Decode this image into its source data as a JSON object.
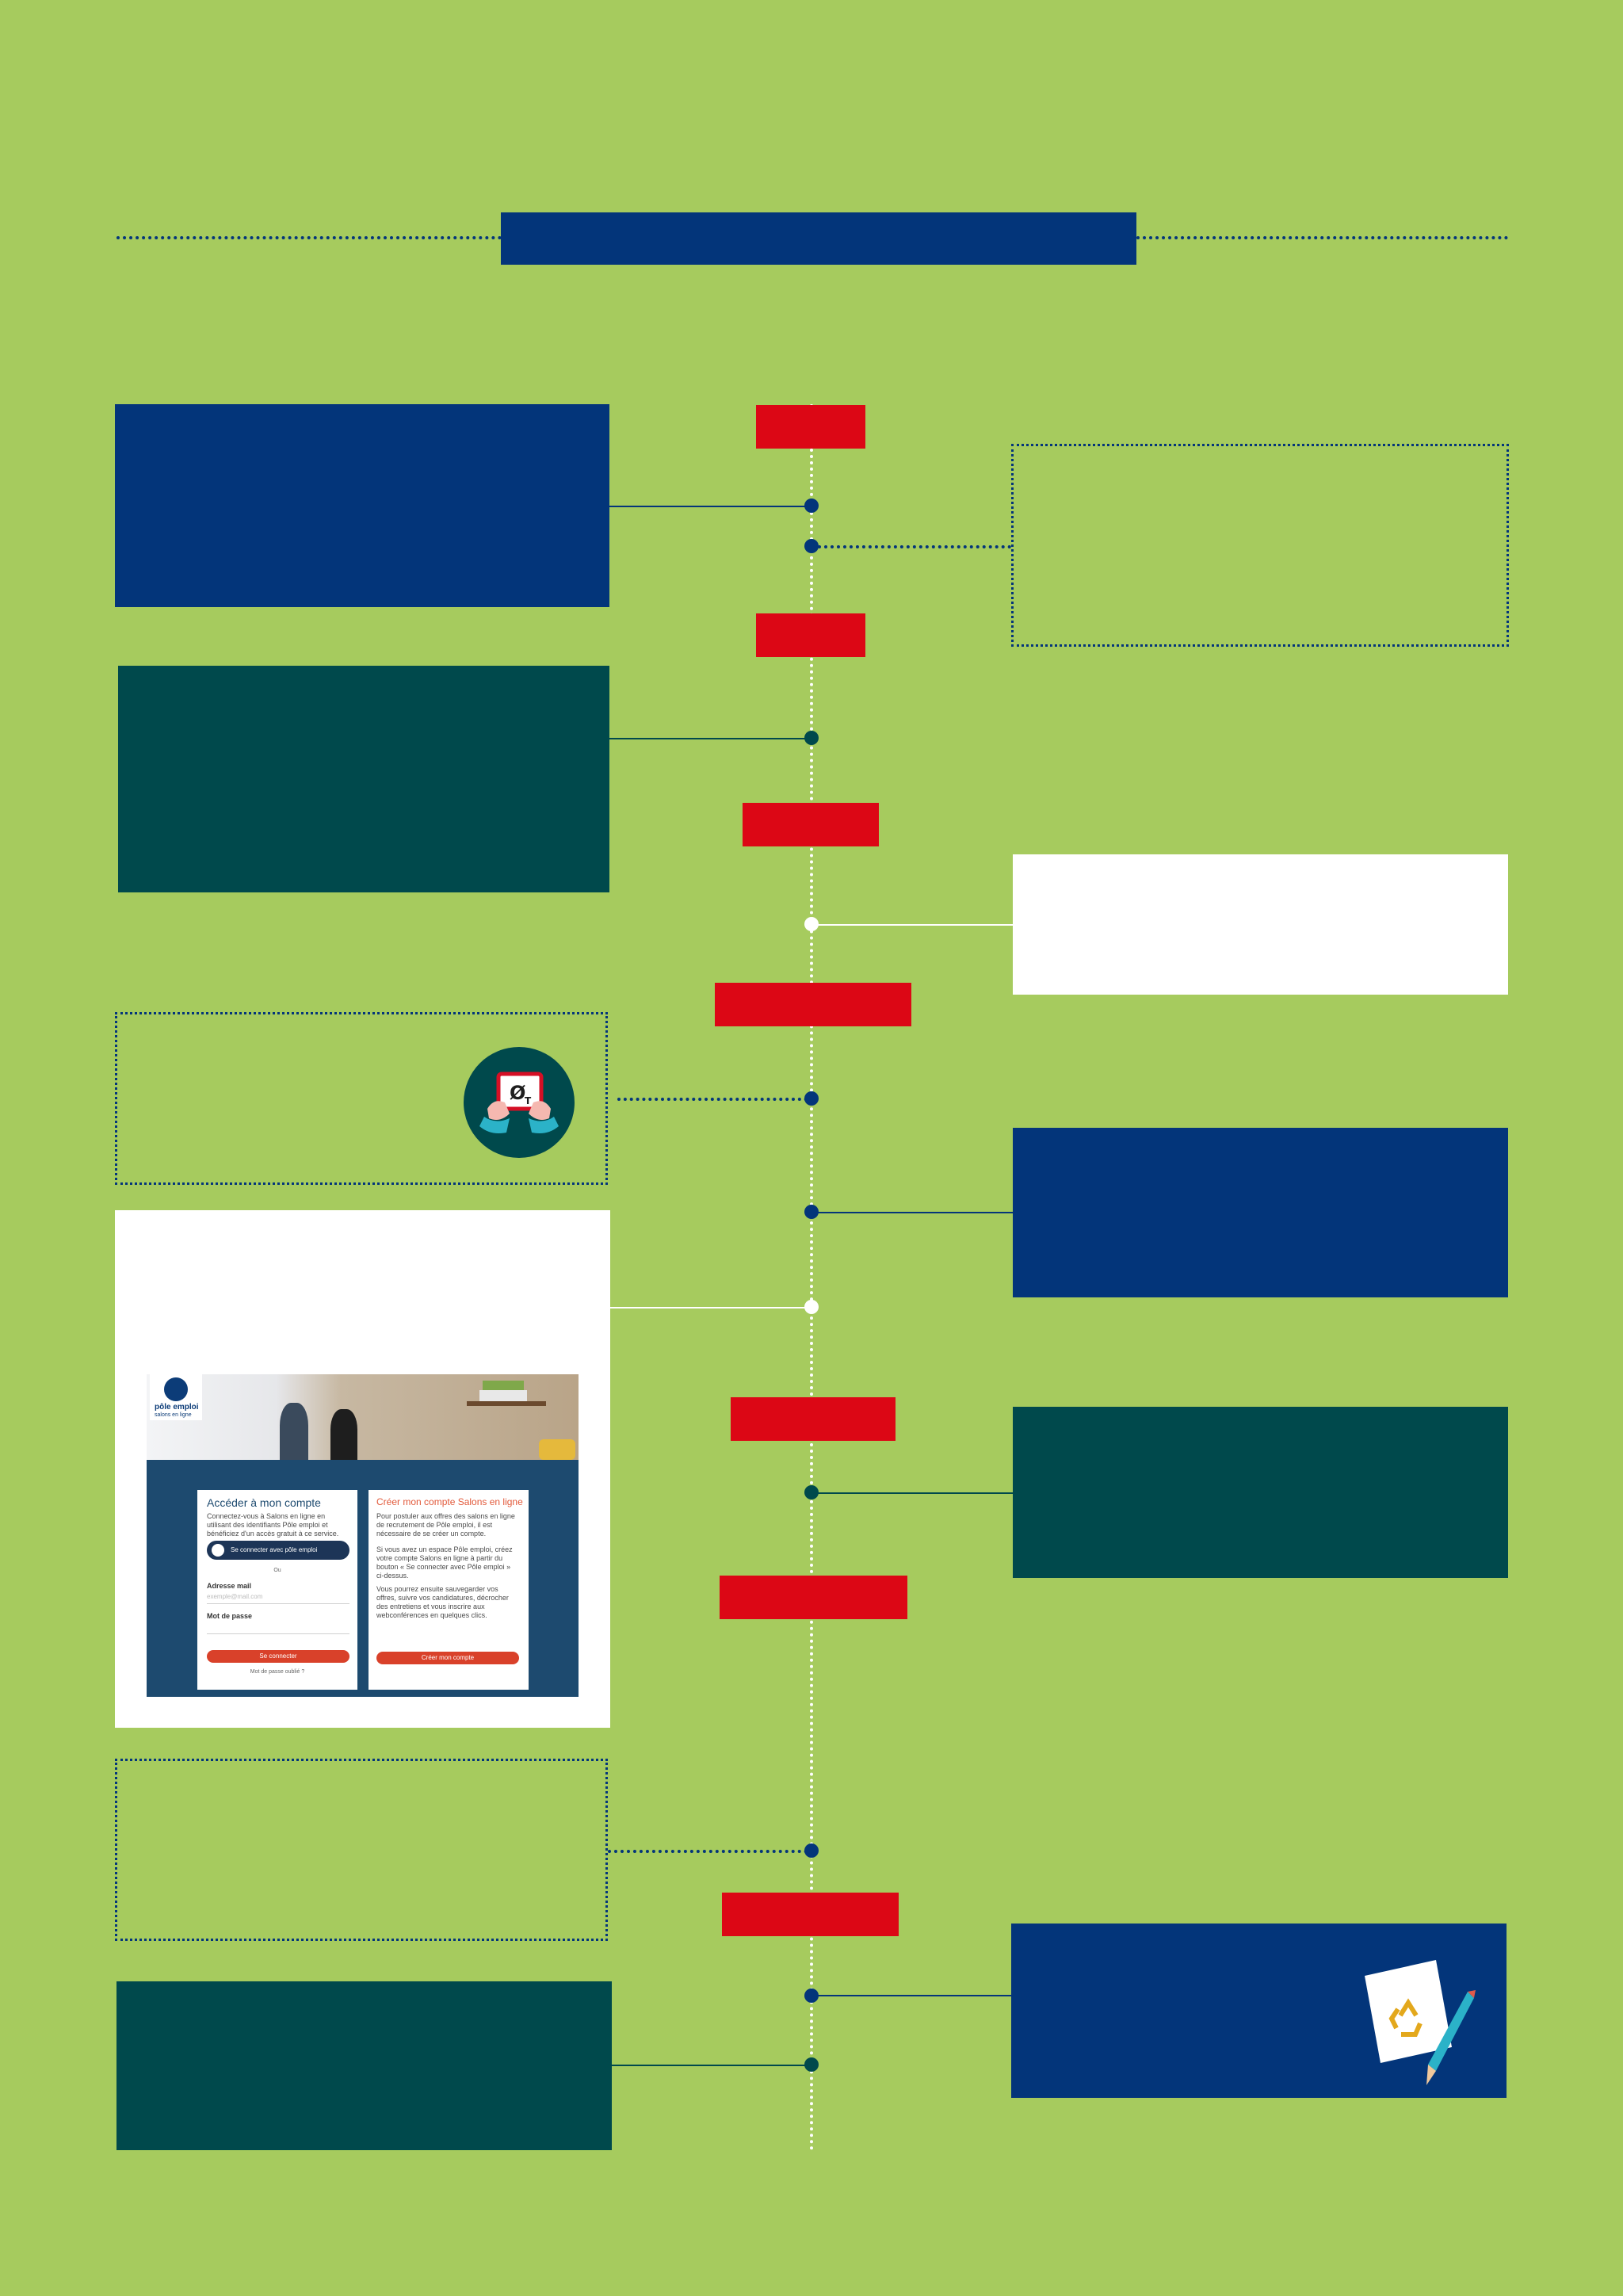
{
  "header": {
    "title": ""
  },
  "screenshot": {
    "logo": {
      "brand": "pôle emploi",
      "tagline": "salons en ligne"
    },
    "login_panel": {
      "title": "Accéder à mon compte",
      "intro": "Connectez-vous à Salons en ligne en utilisant des identifiants Pôle emploi et bénéficiez d'un accès gratuit à ce service.",
      "pe_button": "Se connecter avec pôle emploi",
      "separator": "Ou",
      "email_label": "Adresse mail",
      "email_placeholder": "exemple@mail.com",
      "password_label": "Mot de passe",
      "submit_button": "Se connecter",
      "forgot_link": "Mot de passe oublié ?"
    },
    "signup_panel": {
      "title": "Créer mon compte Salons en ligne",
      "para1": "Pour postuler aux offres des salons en ligne de recrutement de Pôle emploi, il est nécessaire de se créer un compte.",
      "para2": "Si vous avez un espace Pôle emploi, créez votre compte Salons en ligne à partir du bouton « Se connecter avec Pôle emploi » ci-dessus.",
      "para3": "Vous pourrez ensuite sauvegarder vos offres, suivre vos candidatures, décrocher des entretiens et vous inscrire aux webconférences en quelques clics.",
      "create_button": "Créer mon compte"
    }
  },
  "icons": {
    "tablet": "tablet-hands-icon",
    "document": "recycle-document-pencil-icon"
  },
  "colors": {
    "background": "#a6cb5e",
    "navy": "#03357a",
    "teal": "#00494c",
    "red": "#dc0715",
    "white": "#ffffff"
  }
}
